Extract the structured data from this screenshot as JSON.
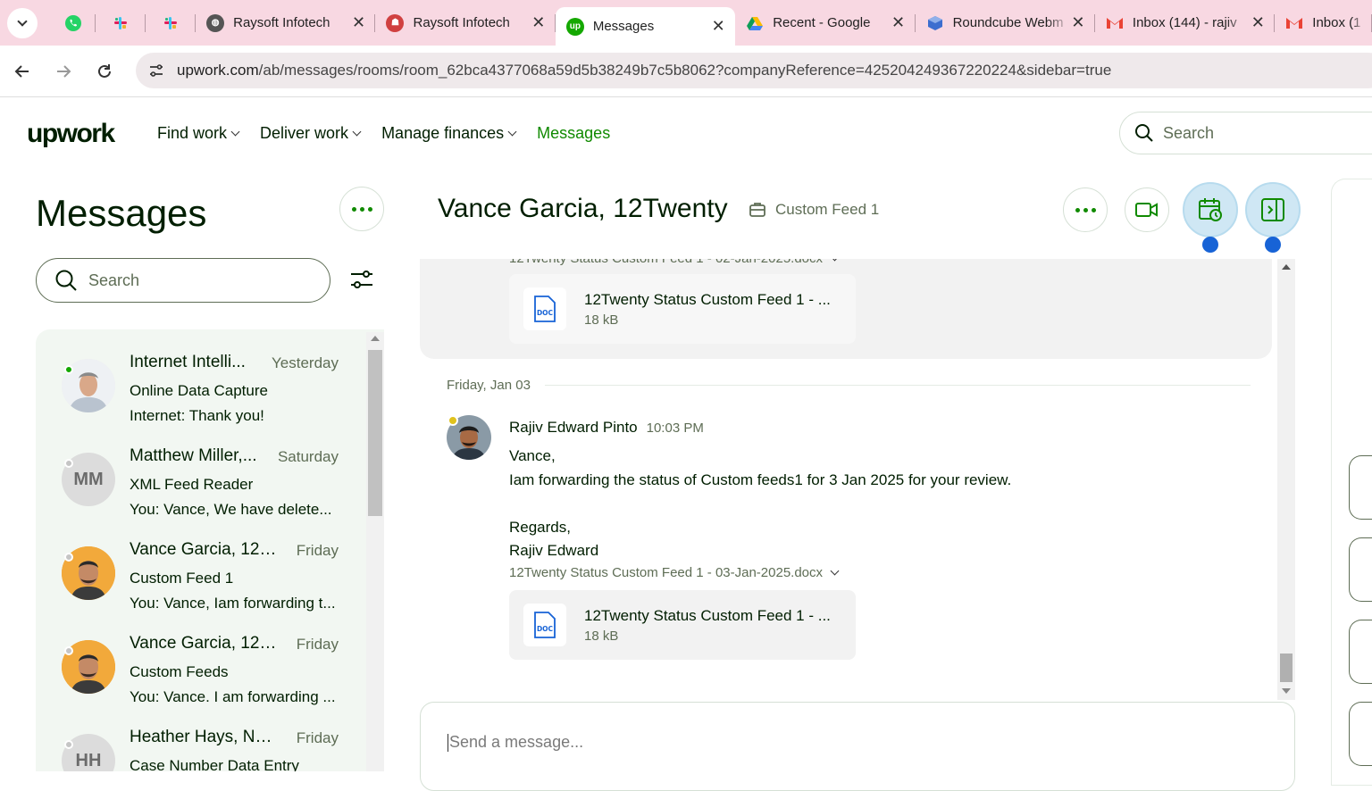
{
  "browser": {
    "tabs": [
      {
        "title": "Raysoft Infotech",
        "favicon_color": "#555555"
      },
      {
        "title": "Raysoft Infotech",
        "favicon_color": "#d04040"
      },
      {
        "title": "Messages",
        "favicon_color": "#14a800",
        "favicon_text": "up",
        "active": true
      },
      {
        "title": "Recent - Google",
        "favicon_color": "#fbbc04"
      },
      {
        "title": "Roundcube Webm",
        "favicon_color": "#3c6ecf"
      },
      {
        "title": "Inbox (144) - rajiv",
        "favicon_color": "#ea4335"
      },
      {
        "title": "Inbox (1"
      }
    ],
    "url_host": "upwork.com",
    "url_path": "/ab/messages/rooms/room_62bca4377068a59d5b38249b7c5b8062?companyReference=425204249367220224&sidebar=true"
  },
  "header": {
    "logo": "upwork",
    "nav": [
      {
        "label": "Find work"
      },
      {
        "label": "Deliver work"
      },
      {
        "label": "Manage finances"
      },
      {
        "label": "Messages"
      }
    ],
    "search_placeholder": "Search"
  },
  "sidebar": {
    "title": "Messages",
    "search_placeholder": "Search",
    "rooms": [
      {
        "name": "Internet Intelli...",
        "date": "Yesterday",
        "subject": "Online Data Capture",
        "preview": "Internet: Thank you!",
        "online": true
      },
      {
        "name": "Matthew Miller,...",
        "date": "Saturday",
        "subject": "XML Feed Reader",
        "preview": "You: Vance, We have delete...",
        "initials": "MM"
      },
      {
        "name": "Vance Garcia, 12T...",
        "date": "Friday",
        "subject": "Custom Feed 1",
        "preview": "You: Vance, Iam forwarding t..."
      },
      {
        "name": "Vance Garcia, 12T...",
        "date": "Friday",
        "subject": "Custom Feeds",
        "preview": "You: Vance. I am forwarding ..."
      },
      {
        "name": "Heather Hays, Na...",
        "date": "Friday",
        "subject": "Case Number Data Entry",
        "preview": "",
        "initials": "HH"
      }
    ]
  },
  "chat": {
    "title": "Vance Garcia, 12Twenty",
    "contract": "Custom Feed 1",
    "prev_file_caption": "12Twenty Status Custom Feed 1 - 02-Jan-2025.docx",
    "prev_file_name": "12Twenty Status Custom Feed 1 - ...",
    "prev_file_size": "18 kB",
    "day": "Friday, Jan 03",
    "sender": "Rajiv Edward Pinto",
    "time": "10:03 PM",
    "body": [
      "Vance,",
      "Iam forwarding the status of Custom feeds1 for 3 Jan 2025 for your review.",
      "",
      "Regards,",
      "Rajiv Edward"
    ],
    "file_caption": "12Twenty Status Custom Feed 1 - 03-Jan-2025.docx",
    "file_name": "12Twenty Status Custom Feed 1 - ...",
    "file_size": "18 kB",
    "composer_placeholder": "Send a message..."
  },
  "colors": {
    "brand": "#14a800",
    "text": "#001e00",
    "accent_blue": "#1763d6"
  }
}
